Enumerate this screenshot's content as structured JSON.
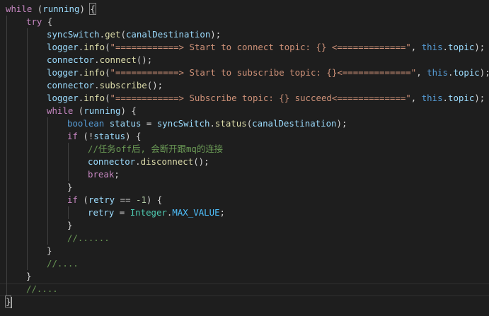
{
  "editor": {
    "lines": [
      {
        "indent": 0,
        "tokens": [
          {
            "t": "ctrl",
            "v": "while"
          },
          {
            "t": "plain",
            "v": " ("
          },
          {
            "t": "var",
            "v": "running"
          },
          {
            "t": "plain",
            "v": ") "
          },
          {
            "t": "bm",
            "v": "{"
          }
        ]
      },
      {
        "indent": 1,
        "tokens": [
          {
            "t": "ctrl",
            "v": "try"
          },
          {
            "t": "plain",
            "v": " {"
          }
        ]
      },
      {
        "indent": 2,
        "tokens": [
          {
            "t": "var",
            "v": "syncSwitch"
          },
          {
            "t": "plain",
            "v": "."
          },
          {
            "t": "fn",
            "v": "get"
          },
          {
            "t": "plain",
            "v": "("
          },
          {
            "t": "var",
            "v": "canalDestination"
          },
          {
            "t": "plain",
            "v": ");"
          }
        ]
      },
      {
        "indent": 2,
        "tokens": [
          {
            "t": "var",
            "v": "logger"
          },
          {
            "t": "plain",
            "v": "."
          },
          {
            "t": "fn",
            "v": "info"
          },
          {
            "t": "plain",
            "v": "("
          },
          {
            "t": "str",
            "v": "\"============> Start to connect topic: {} <=============\""
          },
          {
            "t": "plain",
            "v": ", "
          },
          {
            "t": "this",
            "v": "this"
          },
          {
            "t": "plain",
            "v": "."
          },
          {
            "t": "var",
            "v": "topic"
          },
          {
            "t": "plain",
            "v": ");"
          }
        ]
      },
      {
        "indent": 2,
        "tokens": [
          {
            "t": "var",
            "v": "connector"
          },
          {
            "t": "plain",
            "v": "."
          },
          {
            "t": "fn",
            "v": "connect"
          },
          {
            "t": "plain",
            "v": "();"
          }
        ]
      },
      {
        "indent": 2,
        "tokens": [
          {
            "t": "var",
            "v": "logger"
          },
          {
            "t": "plain",
            "v": "."
          },
          {
            "t": "fn",
            "v": "info"
          },
          {
            "t": "plain",
            "v": "("
          },
          {
            "t": "str",
            "v": "\"============> Start to subscribe topic: {}<=============\""
          },
          {
            "t": "plain",
            "v": ", "
          },
          {
            "t": "this",
            "v": "this"
          },
          {
            "t": "plain",
            "v": "."
          },
          {
            "t": "var",
            "v": "topic"
          },
          {
            "t": "plain",
            "v": ");"
          }
        ]
      },
      {
        "indent": 2,
        "tokens": [
          {
            "t": "var",
            "v": "connector"
          },
          {
            "t": "plain",
            "v": "."
          },
          {
            "t": "fn",
            "v": "subscribe"
          },
          {
            "t": "plain",
            "v": "();"
          }
        ]
      },
      {
        "indent": 2,
        "tokens": [
          {
            "t": "var",
            "v": "logger"
          },
          {
            "t": "plain",
            "v": "."
          },
          {
            "t": "fn",
            "v": "info"
          },
          {
            "t": "plain",
            "v": "("
          },
          {
            "t": "str",
            "v": "\"============> Subscribe topic: {} succeed<=============\""
          },
          {
            "t": "plain",
            "v": ", "
          },
          {
            "t": "this",
            "v": "this"
          },
          {
            "t": "plain",
            "v": "."
          },
          {
            "t": "var",
            "v": "topic"
          },
          {
            "t": "plain",
            "v": ");"
          }
        ]
      },
      {
        "indent": 2,
        "tokens": [
          {
            "t": "ctrl",
            "v": "while"
          },
          {
            "t": "plain",
            "v": " ("
          },
          {
            "t": "var",
            "v": "running"
          },
          {
            "t": "plain",
            "v": ") {"
          }
        ]
      },
      {
        "indent": 3,
        "tokens": [
          {
            "t": "kw",
            "v": "boolean"
          },
          {
            "t": "plain",
            "v": " "
          },
          {
            "t": "var",
            "v": "status"
          },
          {
            "t": "plain",
            "v": " = "
          },
          {
            "t": "var",
            "v": "syncSwitch"
          },
          {
            "t": "plain",
            "v": "."
          },
          {
            "t": "fn",
            "v": "status"
          },
          {
            "t": "plain",
            "v": "("
          },
          {
            "t": "var",
            "v": "canalDestination"
          },
          {
            "t": "plain",
            "v": ");"
          }
        ]
      },
      {
        "indent": 3,
        "tokens": [
          {
            "t": "ctrl",
            "v": "if"
          },
          {
            "t": "plain",
            "v": " (!"
          },
          {
            "t": "var",
            "v": "status"
          },
          {
            "t": "plain",
            "v": ") {"
          }
        ]
      },
      {
        "indent": 4,
        "tokens": [
          {
            "t": "cm",
            "v": "//任务off后, 会断开跟mq的连接"
          }
        ]
      },
      {
        "indent": 4,
        "tokens": [
          {
            "t": "var",
            "v": "connector"
          },
          {
            "t": "plain",
            "v": "."
          },
          {
            "t": "fn",
            "v": "disconnect"
          },
          {
            "t": "plain",
            "v": "();"
          }
        ]
      },
      {
        "indent": 4,
        "tokens": [
          {
            "t": "ctrl",
            "v": "break"
          },
          {
            "t": "plain",
            "v": ";"
          }
        ]
      },
      {
        "indent": 3,
        "tokens": [
          {
            "t": "plain",
            "v": "}"
          }
        ]
      },
      {
        "indent": 3,
        "tokens": [
          {
            "t": "ctrl",
            "v": "if"
          },
          {
            "t": "plain",
            "v": " ("
          },
          {
            "t": "var",
            "v": "retry"
          },
          {
            "t": "plain",
            "v": " == "
          },
          {
            "t": "num",
            "v": "-1"
          },
          {
            "t": "plain",
            "v": ") {"
          }
        ]
      },
      {
        "indent": 4,
        "tokens": [
          {
            "t": "var",
            "v": "retry"
          },
          {
            "t": "plain",
            "v": " = "
          },
          {
            "t": "cls",
            "v": "Integer"
          },
          {
            "t": "plain",
            "v": "."
          },
          {
            "t": "const",
            "v": "MAX_VALUE"
          },
          {
            "t": "plain",
            "v": ";"
          }
        ]
      },
      {
        "indent": 3,
        "tokens": [
          {
            "t": "plain",
            "v": "}"
          }
        ]
      },
      {
        "indent": 3,
        "tokens": [
          {
            "t": "cm",
            "v": "//......"
          }
        ]
      },
      {
        "indent": 2,
        "tokens": [
          {
            "t": "plain",
            "v": "}"
          }
        ]
      },
      {
        "indent": 2,
        "tokens": [
          {
            "t": "cm",
            "v": "//...."
          }
        ]
      },
      {
        "indent": 1,
        "tokens": [
          {
            "t": "plain",
            "v": "}"
          }
        ]
      },
      {
        "indent": 1,
        "tokens": [
          {
            "t": "cm",
            "v": "//...."
          }
        ]
      },
      {
        "indent": 0,
        "tokens": [
          {
            "t": "bm",
            "v": "}"
          },
          {
            "t": "cursor",
            "v": ""
          }
        ]
      }
    ]
  },
  "colors": {
    "background": "#1e1e1e",
    "keyword": "#569cd6",
    "control": "#c586c0",
    "variable": "#9cdcfe",
    "function": "#dcdcaa",
    "string": "#ce9178",
    "comment": "#6a9955",
    "number": "#b5cea8",
    "class": "#4ec9b0",
    "constant": "#4fc1ff"
  }
}
